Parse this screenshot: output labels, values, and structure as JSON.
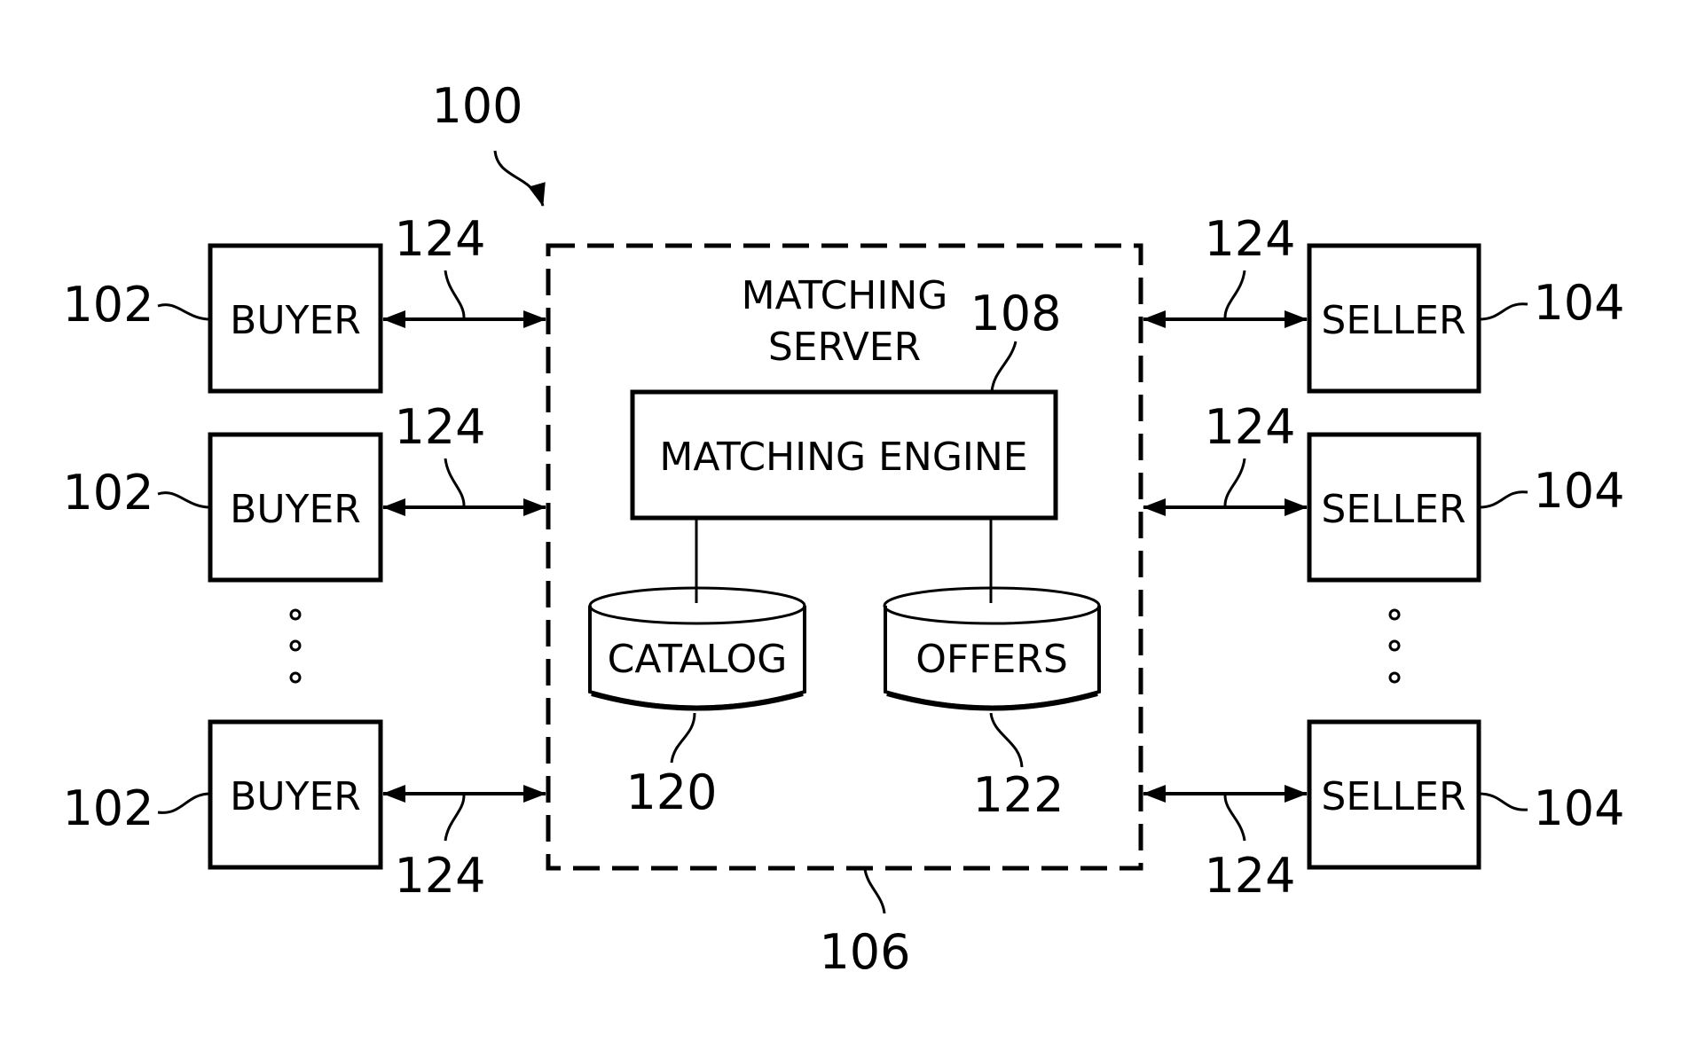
{
  "figure": {
    "system_ref": "100",
    "server": {
      "title_line1": "MATCHING",
      "title_line2": "SERVER",
      "ref": "106"
    },
    "engine": {
      "label": "MATCHING ENGINE",
      "ref": "108"
    },
    "catalog": {
      "label": "CATALOG",
      "ref": "120"
    },
    "offers": {
      "label": "OFFERS",
      "ref": "122"
    },
    "link_ref": "124",
    "buyers": [
      {
        "label": "BUYER",
        "ref": "102"
      },
      {
        "label": "BUYER",
        "ref": "102"
      },
      {
        "label": "BUYER",
        "ref": "102"
      }
    ],
    "sellers": [
      {
        "label": "SELLER",
        "ref": "104"
      },
      {
        "label": "SELLER",
        "ref": "104"
      },
      {
        "label": "SELLER",
        "ref": "104"
      }
    ]
  }
}
